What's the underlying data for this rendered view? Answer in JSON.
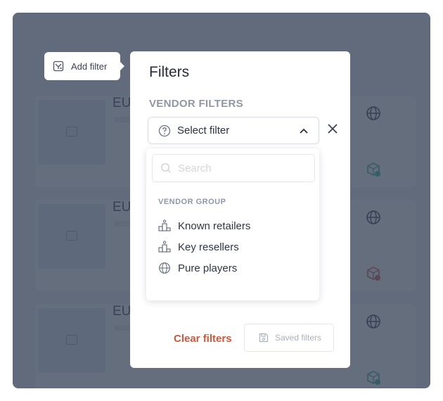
{
  "add_filter": {
    "label": "Add filter"
  },
  "panel": {
    "title": "Filters",
    "section_label": "VENDOR FILTERS",
    "select": {
      "value": "Select filter"
    }
  },
  "dropdown": {
    "search_placeholder": "Search",
    "group_label": "VENDOR GROUP",
    "options": [
      {
        "label": "Known retailers",
        "icon": "podium-icon"
      },
      {
        "label": "Key resellers",
        "icon": "podium-icon"
      },
      {
        "label": "Pure players",
        "icon": "globe-icon"
      }
    ]
  },
  "actions": {
    "clear_label": "Clear filters",
    "saved_label": "Saved filters"
  },
  "background": {
    "rows": [
      {
        "title": "EU"
      },
      {
        "title": "EU"
      },
      {
        "title": "EU"
      }
    ]
  },
  "colors": {
    "overlay": "#3a4558",
    "accent_red": "#d0573a",
    "muted_text": "#8e97a6",
    "green_icon": "#2bb08c",
    "red_icon": "#d04a4a"
  }
}
